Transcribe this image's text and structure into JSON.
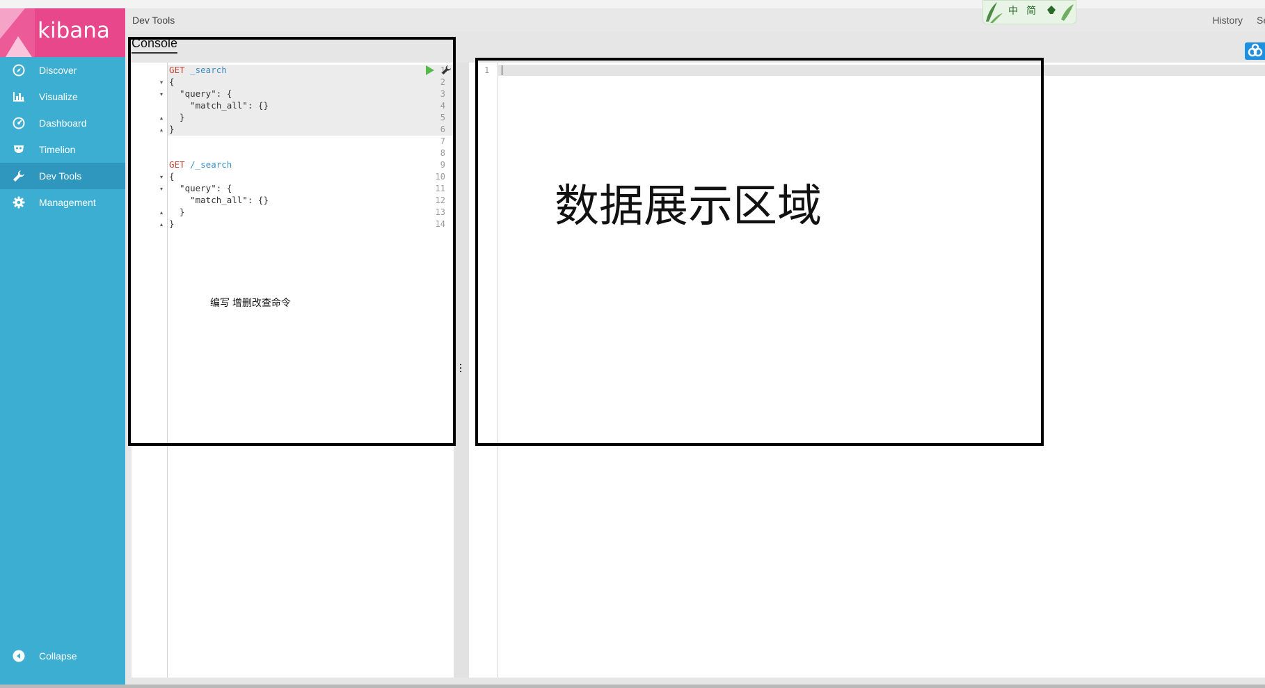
{
  "app": {
    "logo_text": "kibana",
    "brand_color": "#e8488b",
    "sidebar_color": "#3caed2"
  },
  "sidebar": {
    "items": [
      {
        "label": "Discover",
        "icon": "compass-icon"
      },
      {
        "label": "Visualize",
        "icon": "bar-chart-icon"
      },
      {
        "label": "Dashboard",
        "icon": "dashboard-icon"
      },
      {
        "label": "Timelion",
        "icon": "timelion-mask-icon"
      },
      {
        "label": "Dev Tools",
        "icon": "wrench-icon",
        "active": true
      },
      {
        "label": "Management",
        "icon": "gear-icon"
      }
    ],
    "collapse_label": "Collapse"
  },
  "topbar": {
    "breadcrumb": "Dev Tools",
    "history_label": "History",
    "settings_label_cut": "Se"
  },
  "ime_badge": {
    "char1": "中",
    "char2": "简"
  },
  "console": {
    "tab_label": "Console",
    "lines": [
      {
        "n": "1",
        "method": "GET",
        "path": " _search",
        "text": ""
      },
      {
        "n": "2",
        "text": "{"
      },
      {
        "n": "3",
        "text": "  \"query\": {"
      },
      {
        "n": "4",
        "text": "    \"match_all\": {}"
      },
      {
        "n": "5",
        "text": "  }"
      },
      {
        "n": "6",
        "text": "}"
      },
      {
        "n": "7",
        "text": ""
      },
      {
        "n": "8",
        "text": ""
      },
      {
        "n": "9",
        "method": "GET",
        "path": " /_search",
        "text": ""
      },
      {
        "n": "10",
        "text": "{"
      },
      {
        "n": "11",
        "text": "  \"query\": {"
      },
      {
        "n": "12",
        "text": "    \"match_all\": {}"
      },
      {
        "n": "13",
        "text": "  }"
      },
      {
        "n": "14",
        "text": "}"
      }
    ],
    "annotation": "编写 增删改查命令"
  },
  "output": {
    "line_no": "1",
    "annotation": "数据展示区域"
  },
  "accent_colors": {
    "method": "#c44536",
    "path": "#3c8ec4",
    "play": "#54b948"
  }
}
